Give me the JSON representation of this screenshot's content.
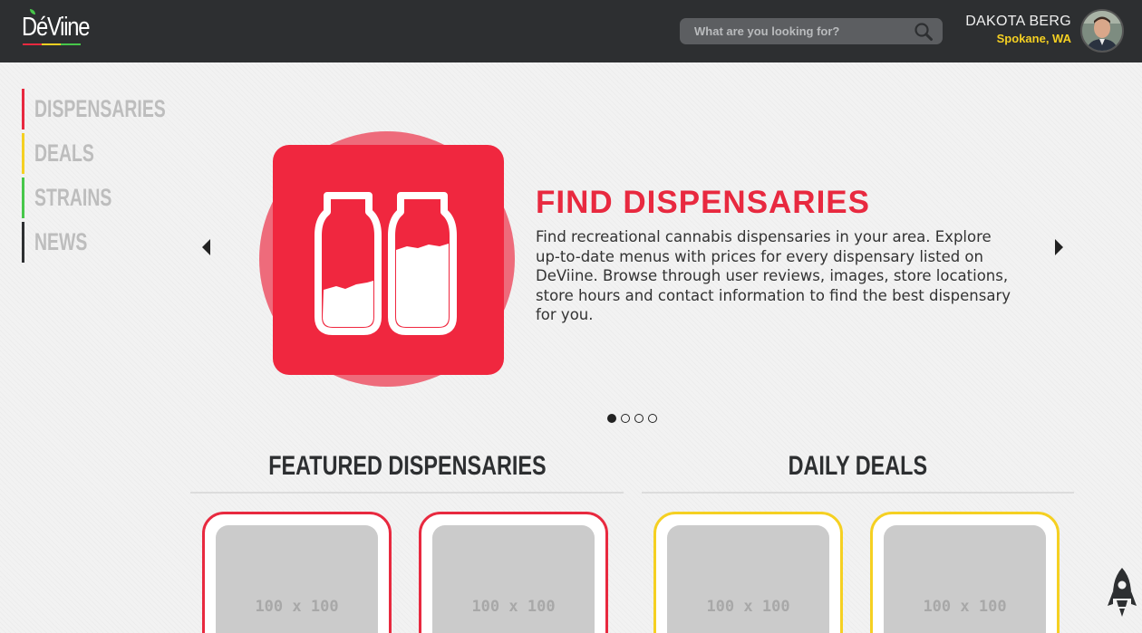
{
  "header": {
    "logo": "DéViine",
    "search_placeholder": "What are you looking for?",
    "user_name": "DAKOTA BERG",
    "user_location": "Spokane, WA"
  },
  "nav": [
    {
      "label": "Dispensaries",
      "color": "#e8293f"
    },
    {
      "label": "Deals",
      "color": "#f5d022"
    },
    {
      "label": "Strains",
      "color": "#47c74a"
    },
    {
      "label": "News",
      "color": "#2d2f31"
    }
  ],
  "hero": {
    "title": "FIND DISPENSARIES",
    "text": "Find recreational cannabis dispensaries in your area. Explore up-to-date menus with prices for every dispensary listed on DeViine. Browse through user reviews, images, store locations, store hours and contact information to find the best dispensary for you.",
    "slide_count": 4,
    "active_slide": 1,
    "accent_color": "#f0273f"
  },
  "featured": {
    "title": "FEATURED DISPENSARIES",
    "border_color": "#e8293f",
    "cards": [
      {
        "label": "100 x 100"
      },
      {
        "label": "100 x 100"
      }
    ]
  },
  "deals": {
    "title": "DAILY DEALS",
    "border_color": "#f5d022",
    "cards": [
      {
        "label": "100 x 100"
      },
      {
        "label": "100 x 100"
      }
    ]
  }
}
